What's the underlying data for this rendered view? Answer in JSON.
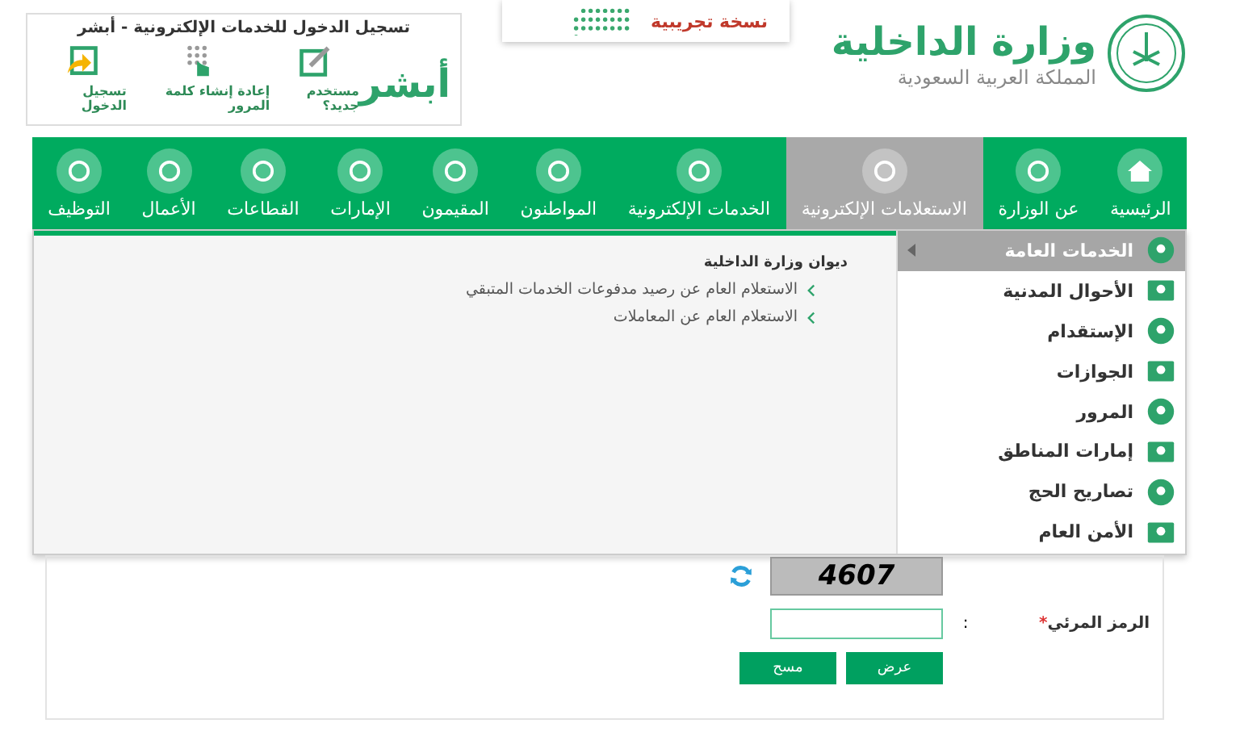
{
  "header": {
    "ministry_name": "وزارة الداخلية",
    "country_name": "المملكة العربية السعودية"
  },
  "banner": {
    "subtitle": "نسخة تجريبية"
  },
  "absher": {
    "title": "تسجيل الدخول للخدمات الإلكترونية - أبشر",
    "logo_text": "أبشر",
    "actions": [
      "مستخدم جديد؟",
      "إعادة إنشاء كلمة المرور",
      "تسجيل الدخول"
    ]
  },
  "nav": [
    {
      "label": "الرئيسية",
      "selected": false
    },
    {
      "label": "عن الوزارة",
      "selected": false
    },
    {
      "label": "الاستعلامات الإلكترونية",
      "selected": true
    },
    {
      "label": "الخدمات الإلكترونية",
      "selected": false
    },
    {
      "label": "المواطنون",
      "selected": false
    },
    {
      "label": "المقيمون",
      "selected": false
    },
    {
      "label": "الإمارات",
      "selected": false
    },
    {
      "label": "القطاعات",
      "selected": false
    },
    {
      "label": "الأعمال",
      "selected": false
    },
    {
      "label": "التوظيف",
      "selected": false
    }
  ],
  "dropdown": {
    "categories": [
      {
        "label": "الخدمات العامة",
        "selected": true
      },
      {
        "label": "الأحوال المدنية",
        "selected": false
      },
      {
        "label": "الإستقدام",
        "selected": false
      },
      {
        "label": "الجوازات",
        "selected": false
      },
      {
        "label": "المرور",
        "selected": false
      },
      {
        "label": "إمارات المناطق",
        "selected": false
      },
      {
        "label": "تصاريح الحج",
        "selected": false
      },
      {
        "label": "الأمن العام",
        "selected": false
      }
    ],
    "group_title": "ديوان وزارة الداخلية",
    "links": [
      "الاستعلام العام عن رصيد مدفوعات الخدمات المتبقي",
      "الاستعلام العام عن المعاملات"
    ]
  },
  "form": {
    "captcha_text": "4607",
    "captcha_label": "الرمز المرئي",
    "required_mark": "*",
    "colon": ":",
    "buttons": [
      "عرض",
      "مسح"
    ]
  }
}
